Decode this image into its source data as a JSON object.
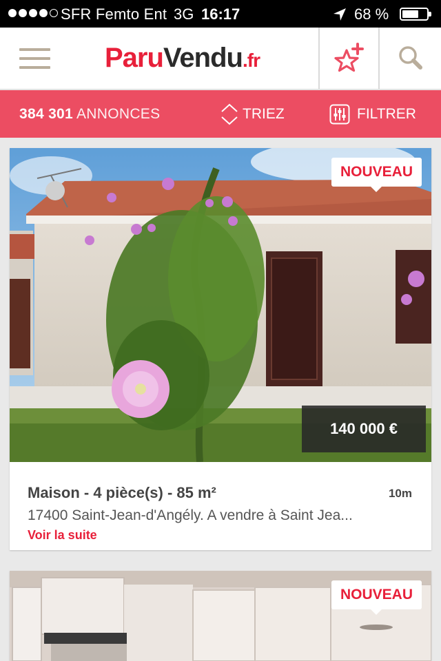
{
  "status_bar": {
    "carrier": "SFR Femto Ent",
    "network": "3G",
    "time": "16:17",
    "battery_percent": "68 %"
  },
  "header": {
    "logo_part1": "Paru",
    "logo_part2": "Vendu",
    "logo_part3": ".fr",
    "icons": [
      "menu-icon",
      "favorite-star-add-icon",
      "search-icon"
    ]
  },
  "toolbar": {
    "count": "384 301",
    "count_label": "ANNONCES",
    "sort_label": "TRIEZ",
    "filter_label": "FILTRER"
  },
  "listings": [
    {
      "badge": "NOUVEAU",
      "price": "140 000 €",
      "title": "Maison - 4 pièce(s) - 85 m²",
      "ago": "10m",
      "description": "17400 Saint-Jean-d'Angély. A vendre à Saint Jea...",
      "more": "Voir la suite"
    },
    {
      "badge": "NOUVEAU"
    }
  ],
  "colors": {
    "accent": "#ec4d62",
    "logo_red": "#e8203a",
    "menu_icon": "#b9ad9b"
  }
}
